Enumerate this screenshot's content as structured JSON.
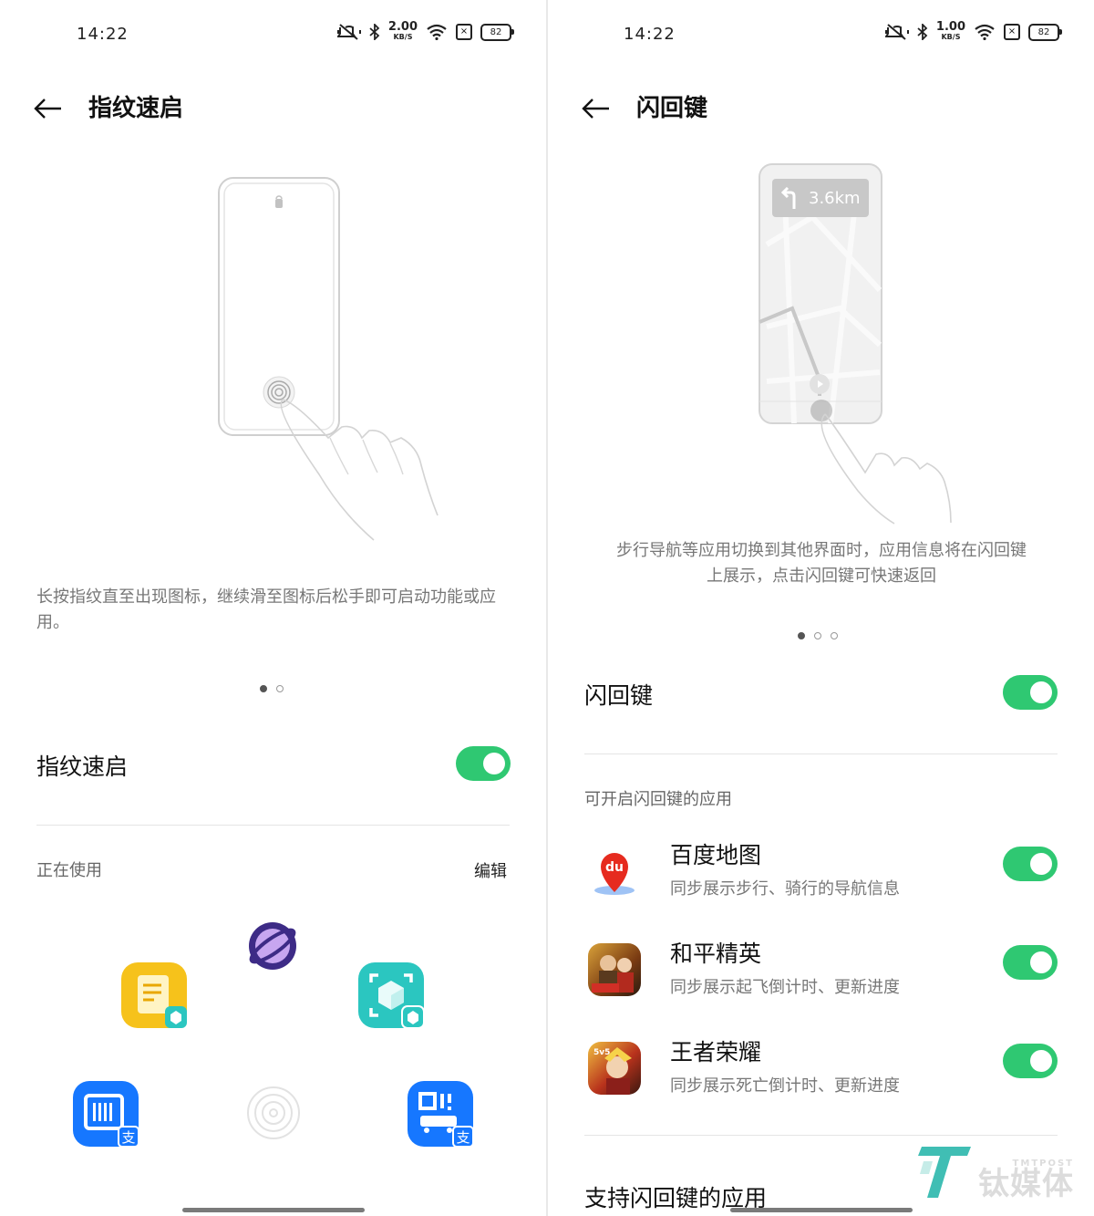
{
  "left": {
    "status": {
      "time": "14:22",
      "speed_value": "2.00",
      "speed_unit": "KB/S",
      "battery": "82"
    },
    "header": {
      "title": "指纹速启"
    },
    "description": "长按指纹直至出现图标，继续滑至图标后松手即可启动功能或应用。",
    "main_toggle": {
      "label": "指纹速启",
      "on": true
    },
    "section": {
      "label": "正在使用",
      "edit_label": "编辑"
    },
    "quick_apps": [
      {
        "icon": "notes-app-icon",
        "color": "#f6c21b"
      },
      {
        "icon": "browser-planet-icon",
        "color": "#5b3fa8"
      },
      {
        "icon": "scanner-cube-icon",
        "color": "#2bc6c0"
      },
      {
        "icon": "alipay-barcode-icon",
        "color": "#1677ff"
      },
      {
        "icon": "alipay-qr-icon",
        "color": "#1677ff"
      }
    ]
  },
  "right": {
    "status": {
      "time": "14:22",
      "speed_value": "1.00",
      "speed_unit": "KB/S",
      "battery": "82"
    },
    "header": {
      "title": "闪回键"
    },
    "nav_badge": "3.6km",
    "description": "步行导航等应用切换到其他界面时，应用信息将在闪回键上展示，点击闪回键可快速返回",
    "main_toggle": {
      "label": "闪回键",
      "on": true
    },
    "section_label": "可开启闪回键的应用",
    "apps": [
      {
        "name": "百度地图",
        "sub": "同步展示步行、骑行的导航信息",
        "on": true,
        "icon": "baidu-map-icon"
      },
      {
        "name": "和平精英",
        "sub": "同步展示起飞倒计时、更新进度",
        "on": true,
        "icon": "peace-elite-icon"
      },
      {
        "name": "王者荣耀",
        "sub": "同步展示死亡倒计时、更新进度",
        "on": true,
        "icon": "honor-of-kings-icon"
      }
    ],
    "bottom_section": "支持闪回键的应用",
    "watermark": {
      "small": "TMTPOST",
      "big": "钛媒体"
    }
  },
  "colors": {
    "toggle_on": "#2fc872",
    "alipay_blue": "#1677ff"
  }
}
